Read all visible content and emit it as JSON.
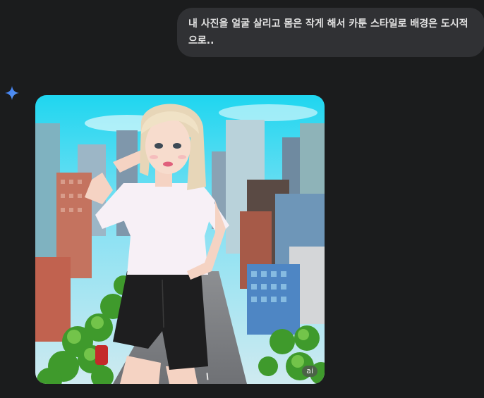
{
  "chat": {
    "user_message": "내 사진을 얼굴 살리고 몸은 작게 해서 카툰 스타일로 배경은 도시적으로..",
    "assistant_icon": "sparkle-icon",
    "generated_image": {
      "badge": "ai",
      "description_icon": "generated-image"
    }
  },
  "colors": {
    "background": "#1b1c1d",
    "bubble": "#303134",
    "accent": "#4a8af4"
  }
}
